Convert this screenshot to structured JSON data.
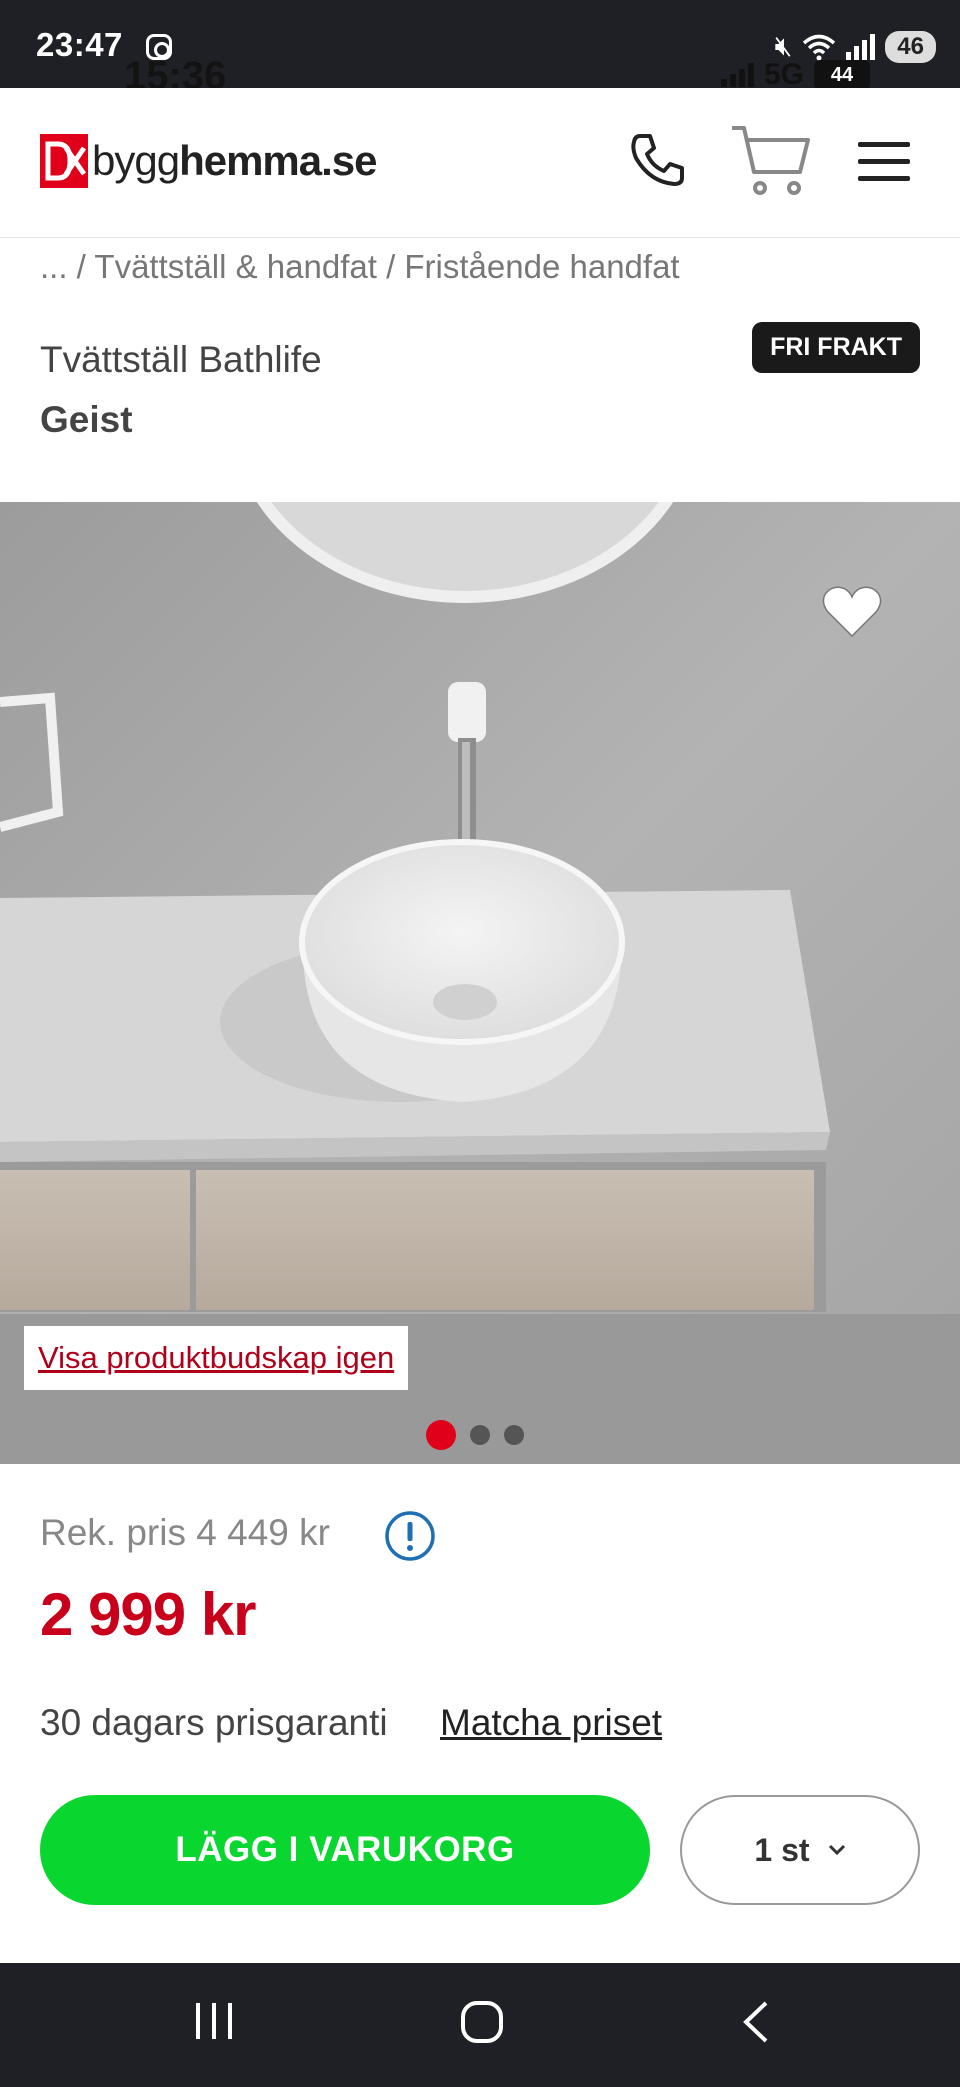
{
  "status_bar": {
    "time": "23:47",
    "ghost_time": "15:36",
    "network": "5G",
    "battery": "46",
    "ghost_battery": "44"
  },
  "header": {
    "logo_prefix": "bygg",
    "logo_suffix": "hemma.se",
    "icons": [
      "phone-icon",
      "cart-icon",
      "menu-icon"
    ]
  },
  "breadcrumb": "... / Tvättställ & handfat / Fristående handfat",
  "product": {
    "name": "Tvättställ Bathlife",
    "variant": "Geist",
    "badge": "FRI FRAKT"
  },
  "gallery": {
    "message_link": "Visa produktbudskap igen",
    "slide_count": 3,
    "active_slide": 1
  },
  "pricing": {
    "rek_price": "Rek. pris 4 449 kr",
    "price": "2 999 kr",
    "guarantee": "30 dagars prisgaranti",
    "match_link": "Matcha priset"
  },
  "actions": {
    "add_to_cart": "LÄGG I VARUKORG",
    "quantity": "1 st"
  },
  "colors": {
    "brand_red": "#e1001a",
    "price_red": "#c8001b",
    "cta_green": "#0ad630",
    "system_bar": "#1f2025"
  }
}
